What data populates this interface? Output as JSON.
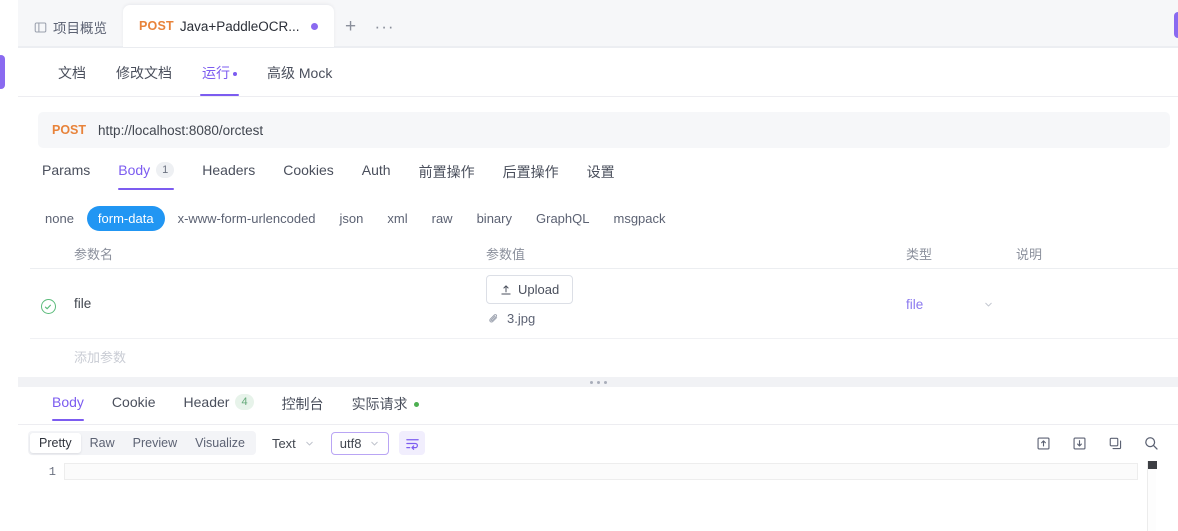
{
  "window": {
    "left_handle": "collapse-handle",
    "right_handle": "panel-handle"
  },
  "tabstrip": {
    "tabs": [
      {
        "id": "overview",
        "icon": "layout-icon",
        "label": "项目概览",
        "active": false,
        "method": "",
        "dirty": false
      },
      {
        "id": "request",
        "icon": "",
        "label": "Java+PaddleOCR...",
        "active": true,
        "method": "POST",
        "dirty": true
      }
    ],
    "add_label": "+",
    "more_label": "···"
  },
  "subnav": {
    "items": [
      {
        "label": "文档",
        "active": false,
        "dot": false
      },
      {
        "label": "修改文档",
        "active": false,
        "dot": false
      },
      {
        "label": "运行",
        "active": true,
        "dot": true
      },
      {
        "label": "高级 Mock",
        "active": false,
        "dot": false
      }
    ]
  },
  "url": {
    "method": "POST",
    "value": "http://localhost:8080/orctest"
  },
  "request_tabs": {
    "items": [
      {
        "label": "Params",
        "active": false,
        "badge": ""
      },
      {
        "label": "Body",
        "active": true,
        "badge": "1"
      },
      {
        "label": "Headers",
        "active": false,
        "badge": ""
      },
      {
        "label": "Cookies",
        "active": false,
        "badge": ""
      },
      {
        "label": "Auth",
        "active": false,
        "badge": ""
      },
      {
        "label": "前置操作",
        "active": false,
        "badge": ""
      },
      {
        "label": "后置操作",
        "active": false,
        "badge": ""
      },
      {
        "label": "设置",
        "active": false,
        "badge": ""
      }
    ]
  },
  "body_types": {
    "items": [
      {
        "label": "none",
        "active": false
      },
      {
        "label": "form-data",
        "active": true
      },
      {
        "label": "x-www-form-urlencoded",
        "active": false
      },
      {
        "label": "json",
        "active": false
      },
      {
        "label": "xml",
        "active": false
      },
      {
        "label": "raw",
        "active": false
      },
      {
        "label": "binary",
        "active": false
      },
      {
        "label": "GraphQL",
        "active": false
      },
      {
        "label": "msgpack",
        "active": false
      }
    ],
    "accent": "#2196f3"
  },
  "param_table": {
    "headers": {
      "name": "参数名",
      "value": "参数值",
      "type": "类型",
      "desc": "说明"
    },
    "rows": [
      {
        "enabled": true,
        "name": "file",
        "upload_label": "Upload",
        "attachment": "3.jpg",
        "type": "file",
        "desc": ""
      }
    ],
    "add_placeholder": "添加参数"
  },
  "response_tabs": {
    "items": [
      {
        "label": "Body",
        "active": true,
        "badge": "",
        "dot": false
      },
      {
        "label": "Cookie",
        "active": false,
        "badge": "",
        "dot": false
      },
      {
        "label": "Header",
        "active": false,
        "badge": "4",
        "dot": false
      },
      {
        "label": "控制台",
        "active": false,
        "badge": "",
        "dot": false
      },
      {
        "label": "实际请求",
        "active": false,
        "badge": "",
        "dot": true
      }
    ]
  },
  "response_toolbar": {
    "view_modes": [
      {
        "label": "Pretty",
        "active": true
      },
      {
        "label": "Raw",
        "active": false
      },
      {
        "label": "Preview",
        "active": false
      },
      {
        "label": "Visualize",
        "active": false
      }
    ],
    "format": "Text",
    "charset": "utf8",
    "wrap_icon": "text-wrap-icon",
    "actions": [
      {
        "icon": "export-icon"
      },
      {
        "icon": "save-icon"
      },
      {
        "icon": "copy-icon"
      },
      {
        "icon": "search-icon"
      }
    ]
  },
  "editor": {
    "lines": [
      "1"
    ],
    "content": ""
  },
  "colors": {
    "accent_purple": "#7c5cf0",
    "accent_blue": "#2196f3",
    "method_orange": "#e8833a",
    "success_green": "#5bbb7b"
  }
}
